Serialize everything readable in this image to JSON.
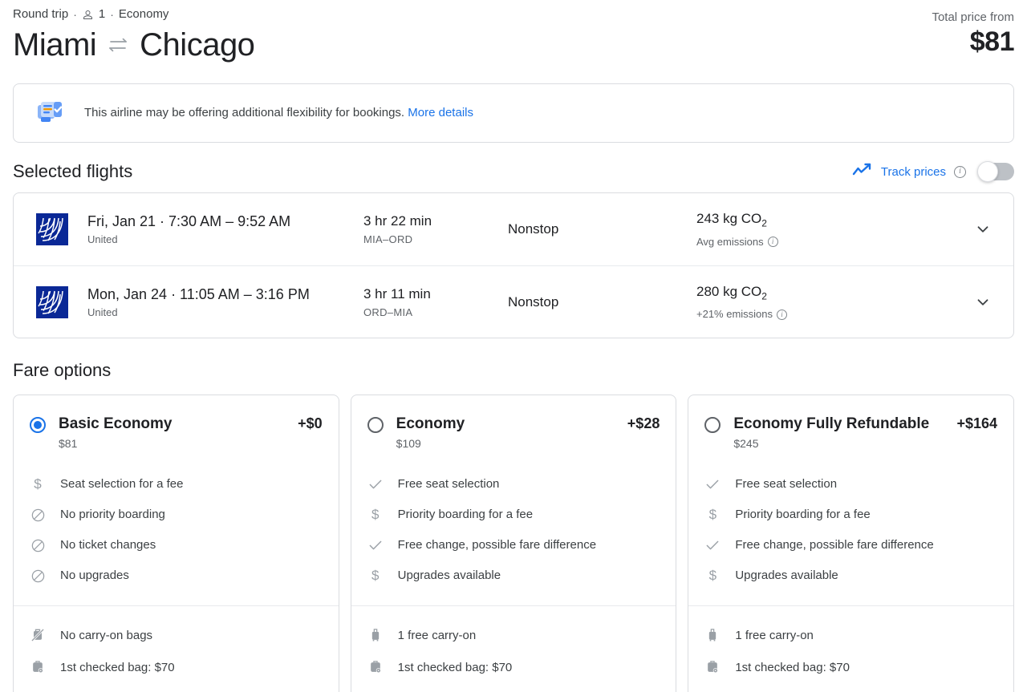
{
  "header": {
    "trip_type": "Round trip",
    "passengers": "1",
    "cabin": "Economy",
    "origin": "Miami",
    "destination": "Chicago",
    "price_label": "Total price from",
    "price_value": "$81",
    "separator": "·",
    "passenger_icon": "person-icon",
    "swap_icon": "swap-arrows-icon"
  },
  "banner": {
    "icon": "boarding-pass-check-icon",
    "text": "This airline may be offering additional flexibility for bookings.",
    "link_label": "More details"
  },
  "selected_flights": {
    "title": "Selected flights",
    "track_prices": {
      "icon": "trending-chart-icon",
      "label": "Track prices",
      "info_icon": "info-icon",
      "toggle_state": "off"
    },
    "flights": [
      {
        "airline_logo": "united-airlines-logo",
        "when": "Fri, Jan 21 · 7:30 AM – 9:52 AM",
        "airline": "United",
        "duration": "3 hr 22 min",
        "route": "MIA–ORD",
        "stops": "Nonstop",
        "emissions": "243 kg CO",
        "emissions_sub_digit": "2",
        "emissions_note": "Avg emissions",
        "expand_icon": "chevron-down-icon"
      },
      {
        "airline_logo": "united-airlines-logo",
        "when": "Mon, Jan 24 · 11:05 AM – 3:16 PM",
        "airline": "United",
        "duration": "3 hr 11 min",
        "route": "ORD–MIA",
        "stops": "Nonstop",
        "emissions": "280 kg CO",
        "emissions_sub_digit": "2",
        "emissions_note": "+21% emissions",
        "expand_icon": "chevron-down-icon"
      }
    ]
  },
  "fare_options": {
    "title": "Fare options",
    "cards": [
      {
        "selected": true,
        "name": "Basic Economy",
        "delta": "+$0",
        "total": "$81",
        "features": [
          {
            "icon": "dollar-icon",
            "text": "Seat selection for a fee"
          },
          {
            "icon": "not-allowed-icon",
            "text": "No priority boarding"
          },
          {
            "icon": "not-allowed-icon",
            "text": "No ticket changes"
          },
          {
            "icon": "not-allowed-icon",
            "text": "No upgrades"
          }
        ],
        "bags": [
          {
            "icon": "carry-on-bag-crossed-icon",
            "text": "No carry-on bags"
          },
          {
            "icon": "checked-bag-icon",
            "text": "1st checked bag: $70"
          }
        ]
      },
      {
        "selected": false,
        "name": "Economy",
        "delta": "+$28",
        "total": "$109",
        "features": [
          {
            "icon": "check-icon",
            "text": "Free seat selection"
          },
          {
            "icon": "dollar-icon",
            "text": "Priority boarding for a fee"
          },
          {
            "icon": "check-icon",
            "text": "Free change, possible fare difference"
          },
          {
            "icon": "dollar-icon",
            "text": "Upgrades available"
          }
        ],
        "bags": [
          {
            "icon": "carry-on-bag-icon",
            "text": "1 free carry-on"
          },
          {
            "icon": "checked-bag-icon",
            "text": "1st checked bag: $70"
          }
        ]
      },
      {
        "selected": false,
        "name": "Economy Fully Refundable",
        "delta": "+$164",
        "total": "$245",
        "features": [
          {
            "icon": "check-icon",
            "text": "Free seat selection"
          },
          {
            "icon": "dollar-icon",
            "text": "Priority boarding for a fee"
          },
          {
            "icon": "check-icon",
            "text": "Free change, possible fare difference"
          },
          {
            "icon": "dollar-icon",
            "text": "Upgrades available"
          }
        ],
        "bags": [
          {
            "icon": "carry-on-bag-icon",
            "text": "1 free carry-on"
          },
          {
            "icon": "checked-bag-icon",
            "text": "1st checked bag: $70"
          }
        ]
      }
    ]
  },
  "colors": {
    "accent_blue": "#1a73e8",
    "text_primary": "#202124",
    "text_secondary": "#5f6368",
    "border": "#dadce0",
    "united_navy": "#0a2896"
  }
}
